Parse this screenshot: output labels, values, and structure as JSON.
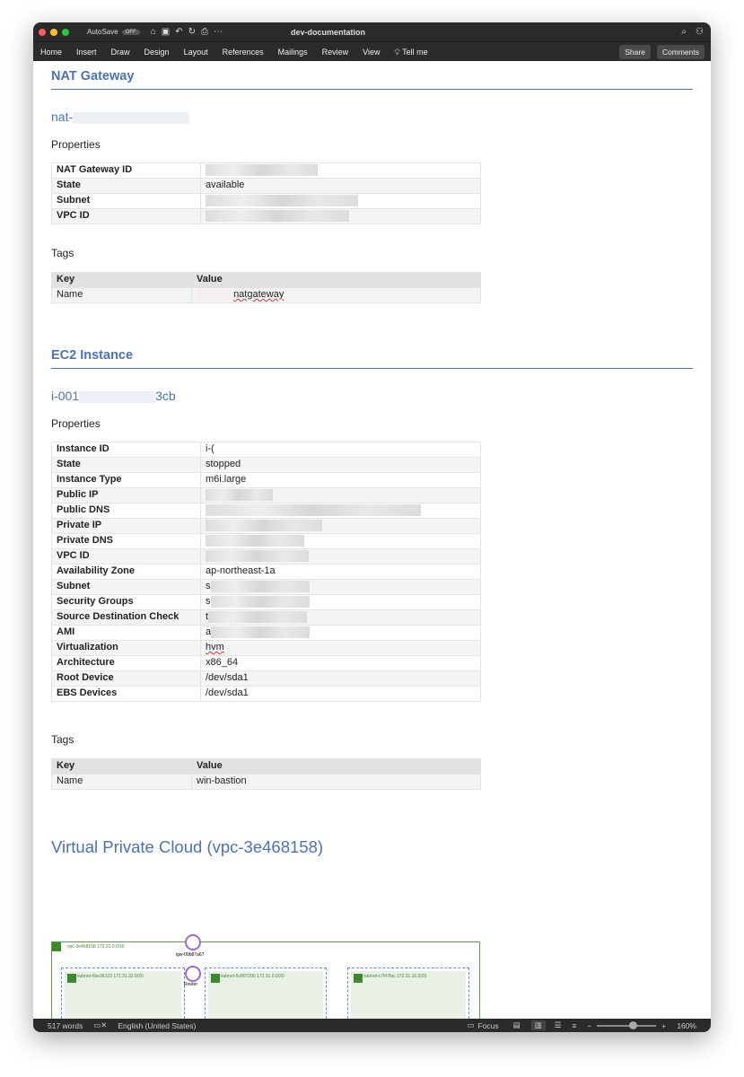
{
  "window": {
    "title": "dev-documentation",
    "autosave": "AutoSave",
    "autosave_state": "OFF"
  },
  "ribbon": {
    "tabs": [
      "Home",
      "Insert",
      "Draw",
      "Design",
      "Layout",
      "References",
      "Mailings",
      "Review",
      "View"
    ],
    "tell_me": "Tell me",
    "share": "Share",
    "comments": "Comments"
  },
  "nat": {
    "heading": "NAT Gateway",
    "name_prefix": "nat-",
    "properties_label": "Properties",
    "properties": [
      {
        "key": "NAT Gateway ID",
        "value": null
      },
      {
        "key": "State",
        "value": "available"
      },
      {
        "key": "Subnet",
        "value": null
      },
      {
        "key": "VPC ID",
        "value": null
      }
    ],
    "tags_label": "Tags",
    "tags_header": {
      "key": "Key",
      "value": "Value"
    },
    "tags": [
      {
        "key": "Name",
        "value": "natgateway"
      }
    ]
  },
  "ec2": {
    "heading": "EC2 Instance",
    "name_prefix": "i-001",
    "name_suffix": "3cb",
    "properties_label": "Properties",
    "properties": [
      {
        "key": "Instance ID",
        "value": "i-("
      },
      {
        "key": "State",
        "value": "stopped"
      },
      {
        "key": "Instance Type",
        "value": "m6i.large"
      },
      {
        "key": "Public IP",
        "value": null
      },
      {
        "key": "Public DNS",
        "value": null
      },
      {
        "key": "Private IP",
        "value": null
      },
      {
        "key": "Private DNS",
        "value": null
      },
      {
        "key": "VPC ID",
        "value": null
      },
      {
        "key": "Availability Zone",
        "value": "ap-northeast-1a"
      },
      {
        "key": "Subnet",
        "value": "s"
      },
      {
        "key": "Security Groups",
        "value": "s"
      },
      {
        "key": "Source Destination Check",
        "value": "t"
      },
      {
        "key": "AMI",
        "value": "a"
      },
      {
        "key": "Virtualization",
        "value": "hvm"
      },
      {
        "key": "Architecture",
        "value": "x86_64"
      },
      {
        "key": "Root Device",
        "value": "/dev/sda1"
      },
      {
        "key": "EBS Devices",
        "value": "/dev/sda1"
      }
    ],
    "tags_label": "Tags",
    "tags_header": {
      "key": "Key",
      "value": "Value"
    },
    "tags": [
      {
        "key": "Name",
        "value": "win-bastion"
      }
    ]
  },
  "vpc": {
    "heading": "Virtual Private Cloud (vpc-3e468158)",
    "vpc_label": "vpc-3e468158 172.31.0.0/16",
    "igw": "igw-00b87a67",
    "router": "Router",
    "subnets": [
      "subnet-6be36323 172.31.32.0/20",
      "subnet-5c807206 172.31.0.0/20",
      "subnet-c7f47fac 172.31.16.0/20"
    ]
  },
  "status": {
    "words": "517 words",
    "language": "English (United States)",
    "focus": "Focus",
    "zoom": "160%",
    "zoom_level": 0.6
  },
  "colors": {
    "heading": "#4a72b8",
    "chrome": "#2b2b2b",
    "vpc_green": "#3b8a2c"
  }
}
